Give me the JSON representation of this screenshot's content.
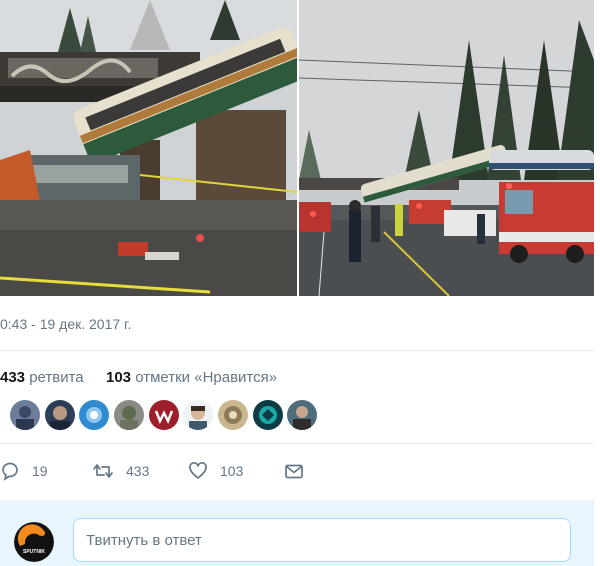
{
  "tweet": {
    "timestamp": "0:43 - 19 дек. 2017 г.",
    "retweets_count": "433",
    "retweets_label": "ретвита",
    "likes_count": "103",
    "likes_label": "отметки «Нравится»",
    "liker_avatars": [
      "avatar-1",
      "avatar-2",
      "avatar-3",
      "avatar-4",
      "avatar-5",
      "avatar-6",
      "avatar-7",
      "avatar-8",
      "avatar-9"
    ]
  },
  "actions": {
    "replies_count": "19",
    "retweets_count": "433",
    "likes_count": "103"
  },
  "reply": {
    "placeholder": "Твитнуть в ответ"
  },
  "reply_avatar": {
    "logo_text": "SPUTNIK"
  },
  "icons": {
    "reply": "speech-bubble-icon",
    "retweet": "retweet-arrows-icon",
    "like": "heart-icon",
    "message": "envelope-icon"
  },
  "colors": {
    "icon_gray": "#657786",
    "reply_bar": "#e8f5fd",
    "reply_border": "#a4d9f9",
    "logo_orange": "#f28a1d"
  }
}
